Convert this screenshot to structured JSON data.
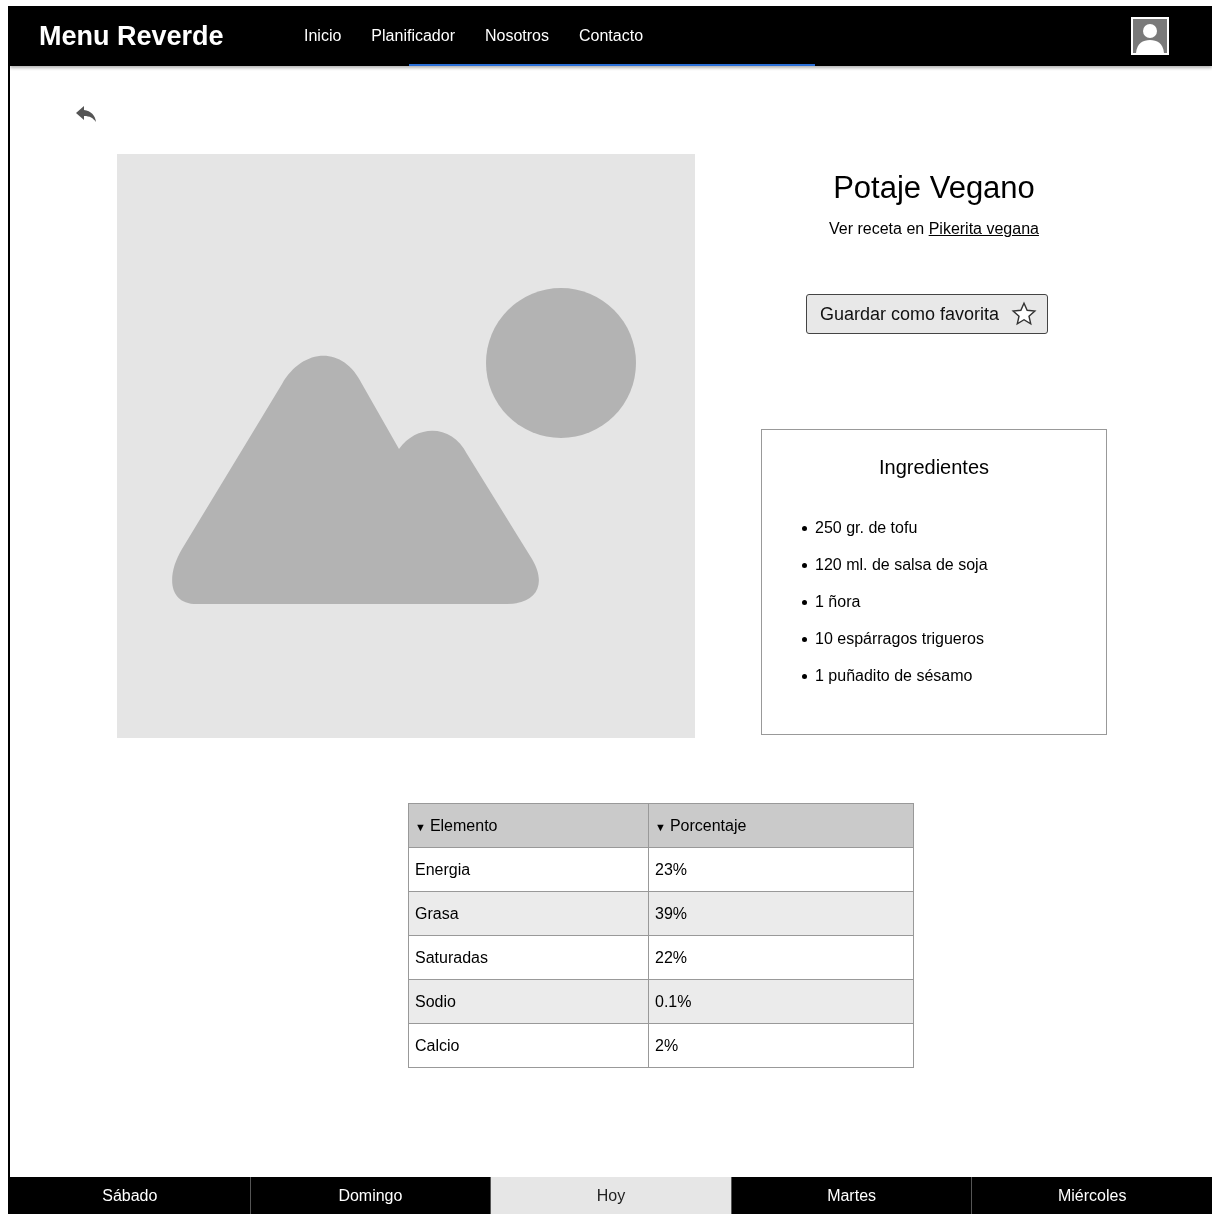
{
  "header": {
    "brand": "Menu Reverde",
    "nav": [
      {
        "label": "Inicio"
      },
      {
        "label": "Planificador"
      },
      {
        "label": "Nosotros"
      },
      {
        "label": "Contacto"
      }
    ]
  },
  "recipe": {
    "title": "Potaje Vegano",
    "source_prefix": "Ver receta en",
    "source_link": "Pikerita vegana",
    "favorite_button": "Guardar como favorita",
    "favorite": false
  },
  "ingredients": {
    "title": "Ingredientes",
    "items": [
      "250 gr. de tofu",
      "120 ml. de salsa de soja",
      "1 ñora",
      "10 espárragos trigueros",
      "1 puñadito de sésamo"
    ]
  },
  "nutrition_table": {
    "columns": [
      {
        "arrow": "▼",
        "label": "Elemento"
      },
      {
        "arrow": "▼",
        "label": "Porcentaje"
      }
    ],
    "rows": [
      [
        "Energia",
        "23%"
      ],
      [
        "Grasa",
        "39%"
      ],
      [
        "Saturadas",
        "22%"
      ],
      [
        "Sodio",
        "0.1%"
      ],
      [
        "Calcio",
        "2%"
      ]
    ]
  },
  "day_tabs": [
    {
      "label": "Sábado",
      "selected": false
    },
    {
      "label": "Domingo",
      "selected": false
    },
    {
      "label": "Hoy",
      "selected": true
    },
    {
      "label": "Martes",
      "selected": false
    },
    {
      "label": "Miércoles",
      "selected": false
    }
  ]
}
